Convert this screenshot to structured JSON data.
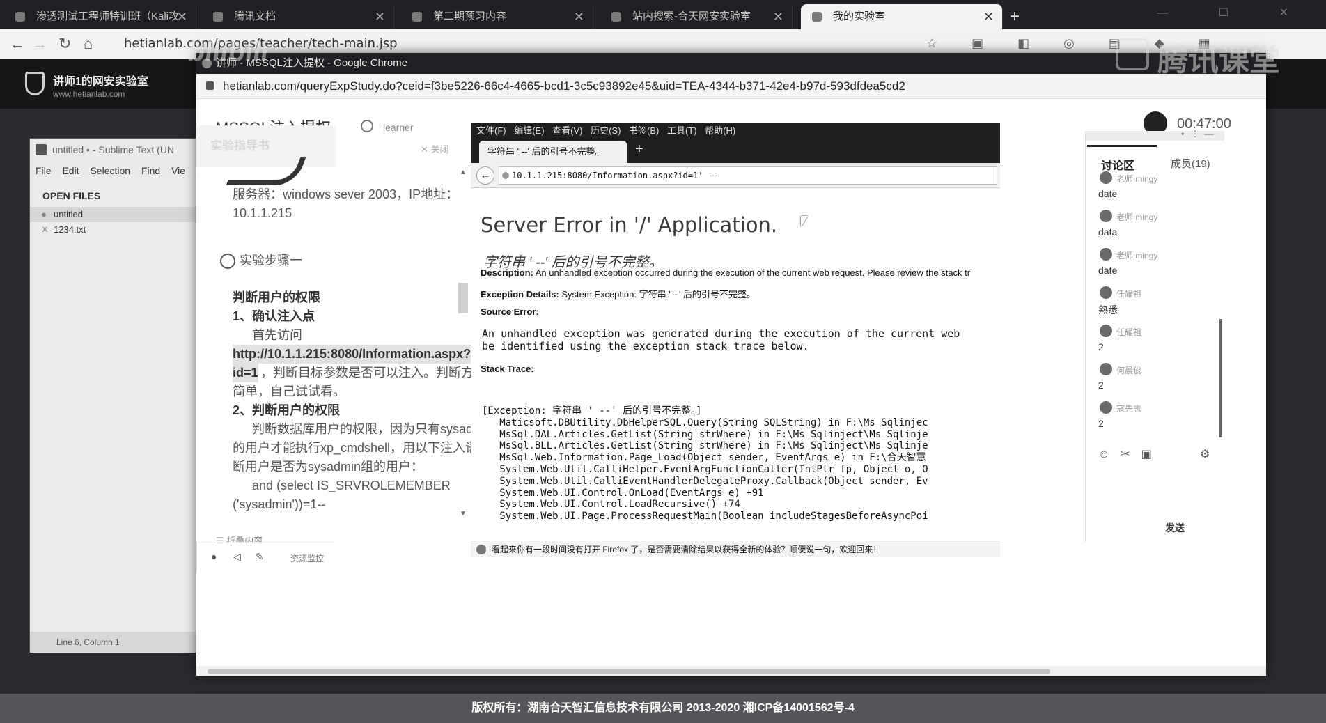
{
  "outer_tabs": [
    {
      "label": "渗透测试工程师特训班（Kali攻",
      "close": "✕"
    },
    {
      "label": "腾讯文档",
      "close": "✕"
    },
    {
      "label": "第二期预习内容",
      "close": "✕"
    },
    {
      "label": "站内搜索-合天网安实验室",
      "close": "✕"
    },
    {
      "label": "我的实验室",
      "close": "✕"
    }
  ],
  "outer_url": "hetianlab.com/pages/teacher/tech-main.jsp",
  "site": {
    "title": "讲师1的网安实验室",
    "subtitle": "www.hetianlab.com"
  },
  "watermark": {
    "left": "bilibili",
    "right": "腾讯课堂"
  },
  "footer": "版权所有：湖南合天智汇信息技术有限公司 2013-2020 湘ICP备14001562号-4",
  "sublime": {
    "title": "untitled • - Sublime Text (UN",
    "menu": "File  Edit  Selection  Find  Vie",
    "open_files": "OPEN FILES",
    "files": [
      "untitled",
      "1234.txt"
    ],
    "status": "Line 6, Column 1"
  },
  "inner": {
    "title": "讲师 - MSSQL注入提权 - Google Chrome",
    "url": "hetianlab.com/queryExpStudy.do?ceid=f3be5226-66c4-4665-bcd1-3c5c93892e45&uid=TEA-4344-b371-42e4-b97d-593dfdea5cd2",
    "course": "MSSQL注入提权",
    "learner": "learner",
    "timer": "00:47:00"
  },
  "guide": {
    "tab": "实验指导书",
    "close": "✕ 关闭",
    "server": "服务器：windows sever 2003，IP地址：",
    "ip": "10.1.1.215",
    "step": "实验步骤一",
    "h1": "判断用户的权限",
    "s1": "1、确认注入点",
    "p1": "首先访问",
    "link1": "http://10.1.1.215:8080/Information.aspx?",
    "link2": "id=1",
    "p2": "，判断目标参数是否可以注入。判断方法比较",
    "p3": "简单，自己试试看。",
    "s2": "2、判断用户的权限",
    "p4": "判断数据库用户的权限，因为只有sysadmin组",
    "p5": "的用户才能执行xp_cmdshell，用以下注入语句判",
    "p6": "断用户是否为sysadmin组的用户：",
    "code1": "and (select IS_SRVROLEMEMBER",
    "code2": "('sysadmin'))=1--",
    "fold": "☰ 折叠内容"
  },
  "firefox": {
    "menu": "文件(F)  编辑(E)  查看(V)  历史(S)  书签(B)  工具(T)  帮助(H)",
    "tab": "字符串 ' --' 后的引号不完整。",
    "url": "10.1.1.215:8080/Information.aspx?id=1' --",
    "heading": "Server Error in '/' Application.",
    "italic": "字符串 ' --' 后的引号不完整。",
    "desc_label": "Description:",
    "desc": " An unhandled exception occurred during the execution of the current web request. Please review the stack tr",
    "exc_label": "Exception Details:",
    "exc": " System.Exception: 字符串 ' --' 后的引号不完整。",
    "src_label": "Source Error:",
    "src_text": "An unhandled exception was generated during the execution of the current web\nbe identified using the exception stack trace below.",
    "stack_label": "Stack Trace:",
    "stack": "[Exception: 字符串 ' --' 后的引号不完整。]\n   Maticsoft.DBUtility.DbHelperSQL.Query(String SQLString) in F:\\Ms_Sqlinjec\n   MsSql.DAL.Articles.GetList(String strWhere) in F:\\Ms_Sqlinject\\Ms_Sqlinje\n   MsSql.BLL.Articles.GetList(String strWhere) in F:\\Ms_Sqlinject\\Ms_Sqlinje\n   MsSql.Web.Information.Page_Load(Object sender, EventArgs e) in F:\\合天智慧\n   System.Web.Util.CalliHelper.EventArgFunctionCaller(IntPtr fp, Object o, O\n   System.Web.Util.CalliEventHandlerDelegateProxy.Callback(Object sender, Ev\n   System.Web.UI.Control.OnLoad(EventArgs e) +91\n   System.Web.UI.Control.LoadRecursive() +74\n   System.Web.UI.Page.ProcessRequestMain(Boolean includeStagesBeforeAsyncPoi",
    "notice": "看起来你有一段时间没有打开 Firefox 了，是否需要清除结果以获得全新的体验？顺便说一句，欢迎回来！"
  },
  "discussion": {
    "tab": "讨论区",
    "members": "成员(19)",
    "messages": [
      {
        "name": "老师 mingy",
        "text": "date"
      },
      {
        "name": "老师 mingy",
        "text": "data"
      },
      {
        "name": "老师 mingy",
        "text": "date"
      },
      {
        "name": "任耀祖",
        "text": "熟悉"
      },
      {
        "name": "任耀祖",
        "text": "2"
      },
      {
        "name": "何晨俊",
        "text": "2"
      },
      {
        "name": "寇先志",
        "text": "2"
      }
    ],
    "send": "发送",
    "resources": "资源监控"
  }
}
